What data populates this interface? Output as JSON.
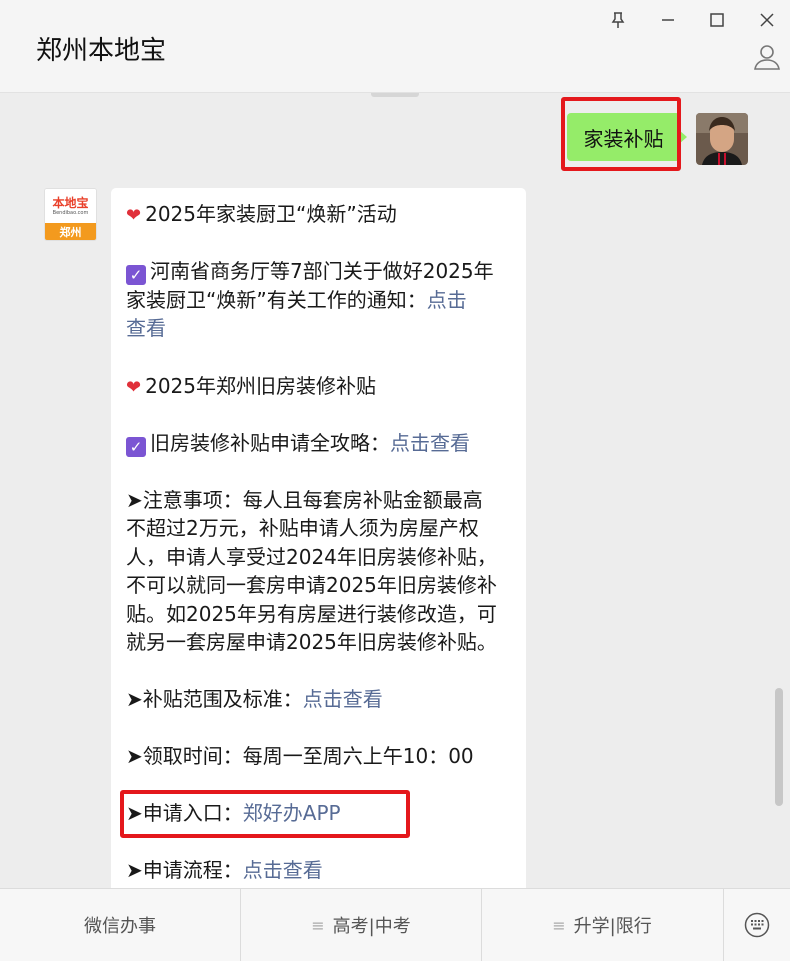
{
  "window": {
    "title": "郑州本地宝",
    "controls": [
      "pin-icon",
      "minimize-icon",
      "maximize-icon",
      "close-icon"
    ]
  },
  "chat": {
    "user_message": "家装补贴",
    "bot_avatar": {
      "logo_text": "本地宝",
      "logo_subtext": "Bendibao.com",
      "city": "郑州"
    },
    "bot_message": {
      "heading1": "2025年家装厨卫“焕新”活动",
      "item1_line1": "河南省商务厅等7部门关于做好2025年",
      "item1_line2": "家装厨卫“焕新”有关工作的通知：",
      "item1_link_a": "点击",
      "item1_link_b": "查看",
      "heading2": "2025年郑州旧房装修补贴",
      "item2_text": "旧房装修补贴申请全攻略：",
      "item2_link": "点击查看",
      "notes_lines": [
        "➤注意事项：每人且每套房补贴金额最高",
        "不超过2万元，补贴申请人须为房屋产权",
        "人，申请人享受过2024年旧房装修补贴，",
        "不可以就同一套房申请2025年旧房装修补",
        "贴。如2025年另有房屋进行装修改造，可",
        "就另一套房屋申请2025年旧房装修补贴。"
      ],
      "scope_label": "➤补贴范围及标准：",
      "scope_link": "点击查看",
      "time_label": "➤领取时间：每周一至周六上午10：00",
      "entry_label": "➤申请入口：",
      "entry_link": "郑好办APP",
      "process_label": "➤申请流程：",
      "process_link": "点击查看"
    }
  },
  "menu": {
    "items": [
      "微信办事",
      "高考|中考",
      "升学|限行"
    ],
    "keyboard_icon": "keyboard-icon"
  },
  "colors": {
    "user_bubble": "#95ec69",
    "link": "#576b95",
    "highlight_box": "#e4181c",
    "check_badge": "#7b55d3",
    "heart": "#e0303a"
  }
}
